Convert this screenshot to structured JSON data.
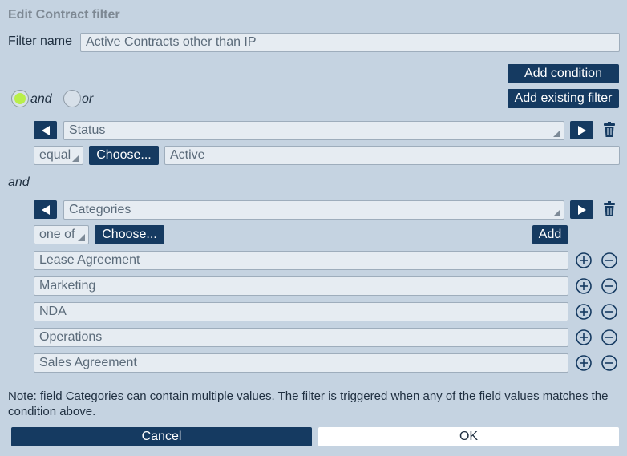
{
  "dialog": {
    "title": "Edit Contract filter"
  },
  "filter_name": {
    "label": "Filter name",
    "value": "Active Contracts other than IP"
  },
  "actions": {
    "add_condition": "Add condition",
    "add_existing_filter": "Add existing filter"
  },
  "logic": {
    "and_label": "and",
    "or_label": "or",
    "selected": "and"
  },
  "condition1": {
    "field": "Status",
    "operator": "equal",
    "choose_label": "Choose...",
    "value": "Active"
  },
  "connector": "and",
  "condition2": {
    "field": "Categories",
    "operator": "one of",
    "choose_label": "Choose...",
    "add_label": "Add",
    "values": [
      "Lease Agreement",
      "Marketing",
      "NDA",
      "Operations",
      "Sales Agreement"
    ]
  },
  "note": "Note: field Categories can contain multiple values. The filter is triggered when any of the field values matches the condition above.",
  "footer": {
    "cancel": "Cancel",
    "ok": "OK"
  },
  "icons": {
    "prev": "triangle-left-icon",
    "next": "triangle-right-icon",
    "delete": "trash-icon",
    "add": "plus-circle-icon",
    "remove": "minus-circle-icon"
  },
  "colors": {
    "background": "#c5d3e1",
    "button": "#153a61",
    "radio_selected": "#b9ef4a"
  }
}
